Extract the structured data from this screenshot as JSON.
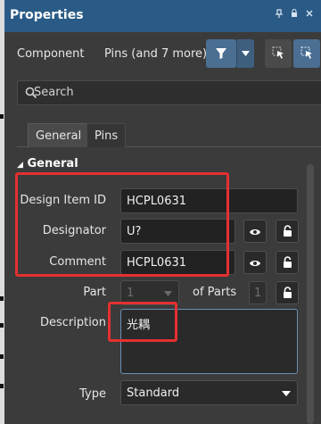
{
  "panel": {
    "title": "Properties",
    "title_buttons": [
      "pin-icon",
      "lock-icon",
      "close-icon"
    ]
  },
  "toolbar": {
    "component_label": "Component",
    "filter_label": "Pins (and 7 more)"
  },
  "search": {
    "placeholder": "Search"
  },
  "tabs": [
    {
      "label": "General",
      "active": true
    },
    {
      "label": "Pins",
      "active": false
    }
  ],
  "section": {
    "title": "General"
  },
  "fields": {
    "design_item_id": {
      "label": "Design Item ID",
      "value": "HCPL0631"
    },
    "designator": {
      "label": "Designator",
      "value": "U?"
    },
    "comment": {
      "label": "Comment",
      "value": "HCPL0631"
    },
    "part": {
      "label": "Part",
      "value": "1",
      "of_parts_label": "of Parts",
      "of_parts_value": "1"
    },
    "description": {
      "label": "Description",
      "value": "光耦"
    },
    "type": {
      "label": "Type",
      "value": "Standard"
    }
  },
  "colors": {
    "titlebar": "#2a5b86",
    "panel_bg": "#3b3b3b",
    "accent": "#4a6f93",
    "highlight_box": "#e53030"
  }
}
